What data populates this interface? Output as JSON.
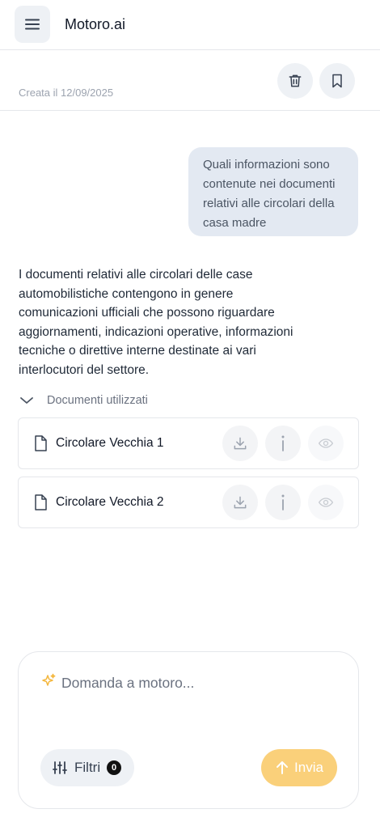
{
  "header": {
    "app_title": "Motoro.ai"
  },
  "conversation": {
    "created_label": "Creata il 12/09/2025"
  },
  "messages": {
    "user": "Quali informazioni sono contenute nei documenti relativi alle circolari della casa madre",
    "assistant": "I documenti relativi alle circolari delle case automobilistiche contengono in genere comunicazioni ufficiali che possono riguardare aggiornamenti, indicazioni operative, informazioni tecniche o direttive interne destinate ai vari interlocutori del settore."
  },
  "documents": {
    "toggle_label": "Documenti utilizzati",
    "items": [
      {
        "name": "Circolare Vecchia 1"
      },
      {
        "name": "Circolare Vecchia 2"
      }
    ],
    "actions": [
      "download-icon",
      "info-icon",
      "eye-icon"
    ]
  },
  "composer": {
    "placeholder": "Domanda a motoro...",
    "filters_label": "Filtri",
    "filters_count": "0",
    "send_label": "Invia"
  },
  "colors": {
    "accent": "#fad07a",
    "spark": "#f4b73f",
    "user_bubble": "#e3e9f2",
    "button_bg": "#eef1f5"
  },
  "icons": {
    "menu": "menu-icon",
    "trash": "trash-icon",
    "bookmark": "bookmark-icon",
    "chevron": "chevron-down-icon",
    "file": "file-icon",
    "sparkles": "sparkles-icon",
    "filters": "sliders-icon",
    "send": "arrow-up-icon"
  }
}
